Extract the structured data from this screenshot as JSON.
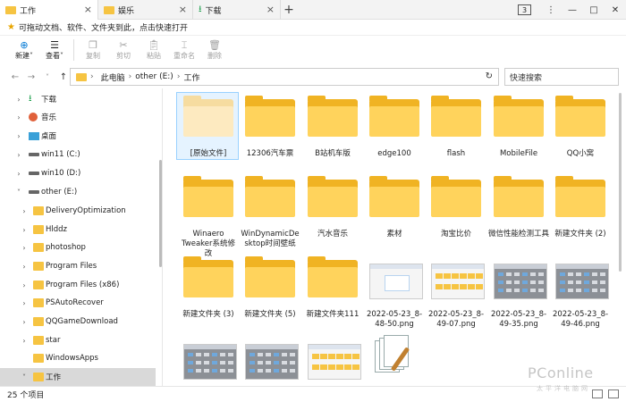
{
  "tabs": [
    {
      "label": "工作",
      "icon": "folder-icon",
      "active": true
    },
    {
      "label": "娱乐",
      "icon": "folder-icon",
      "active": false
    },
    {
      "label": "下载",
      "icon": "download-icon",
      "active": false
    }
  ],
  "tab_count": "3",
  "window_controls": {
    "menu": "⋮",
    "minimize": "—",
    "maximize": "□",
    "close": "✕"
  },
  "hint_text": "可拖动文档、软件、文件夹到此，点击快速打开",
  "ribbon": [
    {
      "label": "新建",
      "icon": "add-icon",
      "enabled": true,
      "dropdown": true
    },
    {
      "label": "查看",
      "icon": "view-icon",
      "enabled": true,
      "dropdown": true
    },
    {
      "label": "复制",
      "icon": "copy-icon",
      "enabled": false
    },
    {
      "label": "剪切",
      "icon": "cut-icon",
      "enabled": false
    },
    {
      "label": "粘贴",
      "icon": "paste-icon",
      "enabled": false
    },
    {
      "label": "重命名",
      "icon": "rename-icon",
      "enabled": false
    },
    {
      "label": "删除",
      "icon": "delete-icon",
      "enabled": false
    }
  ],
  "address": {
    "segments": [
      "此电脑",
      "other (E:)",
      "工作"
    ],
    "search_placeholder": "快速搜索"
  },
  "sidebar": {
    "items": [
      {
        "label": "下载",
        "icon": "download-icon",
        "depth": 1,
        "expanded": false
      },
      {
        "label": "音乐",
        "icon": "music-icon",
        "depth": 1,
        "expanded": false
      },
      {
        "label": "桌面",
        "icon": "desktop-icon",
        "depth": 1,
        "expanded": false
      },
      {
        "label": "win11 (C:)",
        "icon": "drive-icon",
        "depth": 1,
        "expanded": false
      },
      {
        "label": "win10 (D:)",
        "icon": "drive-icon",
        "depth": 1,
        "expanded": false
      },
      {
        "label": "other (E:)",
        "icon": "drive-icon",
        "depth": 1,
        "expanded": true
      },
      {
        "label": "DeliveryOptimization",
        "icon": "folder-icon",
        "depth": 2,
        "expanded": false
      },
      {
        "label": "Hlddz",
        "icon": "folder-icon",
        "depth": 2,
        "expanded": false
      },
      {
        "label": "photoshop",
        "icon": "folder-icon",
        "depth": 2,
        "expanded": false
      },
      {
        "label": "Program Files",
        "icon": "folder-icon",
        "depth": 2,
        "expanded": false
      },
      {
        "label": "Program Files (x86)",
        "icon": "folder-icon",
        "depth": 2,
        "expanded": false
      },
      {
        "label": "PSAutoRecover",
        "icon": "folder-icon",
        "depth": 2,
        "expanded": false
      },
      {
        "label": "QQGameDownload",
        "icon": "folder-icon",
        "depth": 2,
        "expanded": false
      },
      {
        "label": "star",
        "icon": "folder-icon",
        "depth": 2,
        "expanded": false
      },
      {
        "label": "WindowsApps",
        "icon": "folder-icon",
        "depth": 2,
        "expanded": false
      },
      {
        "label": "工作",
        "icon": "folder-icon",
        "depth": 2,
        "expanded": true,
        "selected": true
      }
    ]
  },
  "files": [
    {
      "name": "[原始文件]",
      "kind": "folder-pale",
      "selected": true
    },
    {
      "name": "12306汽车票",
      "kind": "folder"
    },
    {
      "name": "B站机车版",
      "kind": "folder"
    },
    {
      "name": "edge100",
      "kind": "folder"
    },
    {
      "name": "flash",
      "kind": "folder"
    },
    {
      "name": "MobileFile",
      "kind": "folder"
    },
    {
      "name": "QQ小窝",
      "kind": "folder"
    },
    {
      "name": "Winaero Tweaker系统修改",
      "kind": "folder"
    },
    {
      "name": "WinDynamicDesktop时间壁纸",
      "kind": "folder"
    },
    {
      "name": "汽水音乐",
      "kind": "folder"
    },
    {
      "name": "素材",
      "kind": "folder"
    },
    {
      "name": "淘宝比价",
      "kind": "folder"
    },
    {
      "name": "微信性能检测工具",
      "kind": "folder"
    },
    {
      "name": "新建文件夹 (2)",
      "kind": "folder"
    },
    {
      "name": "新建文件夹 (3)",
      "kind": "folder"
    },
    {
      "name": "新建文件夹 (5)",
      "kind": "folder"
    },
    {
      "name": "新建文件夹111",
      "kind": "folder"
    },
    {
      "name": "2022-05-23_8-48-50.png",
      "kind": "image-light"
    },
    {
      "name": "2022-05-23_8-49-07.png",
      "kind": "image-folders"
    },
    {
      "name": "2022-05-23_8-49-35.png",
      "kind": "image-grey"
    },
    {
      "name": "2022-05-23_8-49-46.png",
      "kind": "image-grey"
    },
    {
      "name": "",
      "kind": "image-grey"
    },
    {
      "name": "",
      "kind": "image-grey"
    },
    {
      "name": "",
      "kind": "image-folders"
    },
    {
      "name": "",
      "kind": "document"
    }
  ],
  "status": {
    "item_count": "25 个项目"
  },
  "watermark": {
    "brand": "PConline",
    "sub": "太平洋电脑网"
  },
  "colors": {
    "folder": "#f0b323",
    "folder_front": "#ffd35c",
    "selection": "#e5f3ff",
    "accent": "#0078d4"
  }
}
